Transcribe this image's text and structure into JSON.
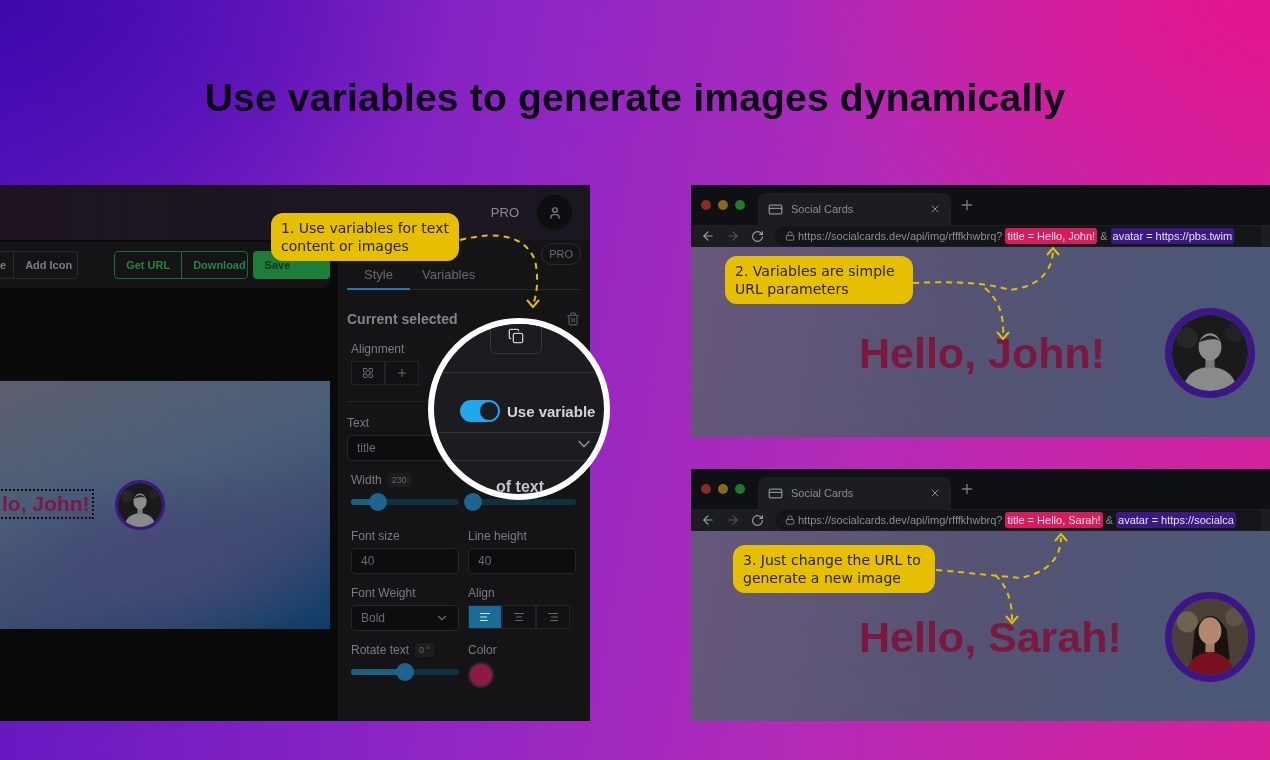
{
  "headline": "Use variables to generate images dynamically",
  "editor": {
    "plan": "PRO",
    "toolbar": {
      "insert_buttons": [
        "e",
        "Add Icon"
      ],
      "export_buttons": [
        "Get URL",
        "Download"
      ],
      "save_button": "Save"
    },
    "canvas": {
      "title": "lo, John!",
      "avatar": {
        "kind": "picture"
      }
    },
    "panel": {
      "tabs": [
        {
          "label": "Style",
          "selected": true
        },
        {
          "label": "Variables",
          "selected": false
        }
      ],
      "pro_badge": "PRO",
      "section_title": "Current selected",
      "alignment": {
        "label": "Alignment",
        "options": [
          {
            "kind": "grid"
          },
          {
            "kind": "cross"
          }
        ]
      },
      "text": {
        "label": "Text",
        "value": "title"
      },
      "width": {
        "label": "Width",
        "reading": "230",
        "level": 0.25
      },
      "font_size": {
        "label": "Font size",
        "value": "40"
      },
      "line_height": {
        "label": "Line height",
        "value": "40"
      },
      "font_weight": {
        "label": "Font Weight",
        "value": "Bold"
      },
      "align": {
        "label": "Align",
        "options": [
          {
            "kind": "left",
            "selected": true
          },
          {
            "kind": "center",
            "selected": false
          },
          {
            "kind": "right",
            "selected": false
          }
        ]
      },
      "rotate": {
        "label": "Rotate text",
        "reading": "0 °",
        "level": 0.5
      },
      "color": {
        "label": "Color",
        "color": "#8c1a44"
      }
    },
    "magnifier": {
      "toggle": {
        "label": "Use variable",
        "on": true
      },
      "lines": {
        "label": "of text",
        "level": 0.05
      }
    },
    "callout": "1. Use variables for text content or images"
  },
  "browsers": [
    {
      "tab_title": "Social Cards",
      "url": "https://socialcards.dev/api/img/rfffkhwbrq?",
      "params": [
        {
          "text": "title = Hello, John!",
          "color": "#d81b5c"
        },
        {
          "text": "avatar = https://pbs.twim",
          "color": "#3a1a82"
        }
      ],
      "separator": "&",
      "callout": "2. Variables are simple URL parameters",
      "heading": "Hello, John!",
      "avatar": {
        "kind": "picture"
      }
    },
    {
      "tab_title": "Social Cards",
      "url": "https://socialcards.dev/api/img/rfffkhwbrq?",
      "params": [
        {
          "text": "title = Hello, Sarah!",
          "color": "#d81b5c"
        },
        {
          "text": "avatar = https://socialca",
          "color": "#3a1a82"
        }
      ],
      "separator": "&",
      "callout": "3. Just change the URL to generate a new image",
      "heading": "Hello, Sarah!",
      "avatar": {
        "kind": "picture"
      }
    }
  ]
}
